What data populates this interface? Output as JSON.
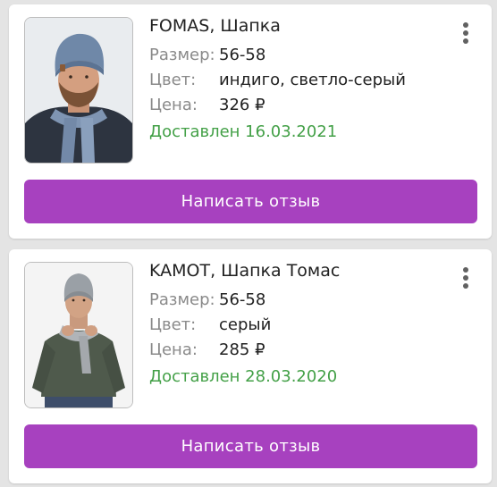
{
  "orders": [
    {
      "title": "FOMAS, Шапка",
      "size_label": "Размер:",
      "size_value": "56-58",
      "color_label": "Цвет:",
      "color_value": "индиго, светло-серый",
      "price_label": "Цена:",
      "price_value": "326 ₽",
      "status": "Доставлен 16.03.2021",
      "button_label": "Написать отзыв",
      "image_icon": "product-photo-hat-scarf"
    },
    {
      "title": "KAMOT, Шапка Томас",
      "size_label": "Размер:",
      "size_value": "56-58",
      "color_label": "Цвет:",
      "color_value": "серый",
      "price_label": "Цена:",
      "price_value": "285 ₽",
      "status": "Доставлен 28.03.2020",
      "button_label": "Написать отзыв",
      "image_icon": "product-photo-hat-sweater"
    }
  ],
  "colors": {
    "accent": "#a741bf",
    "status_green": "#43a047",
    "label_gray": "#8a8a8a",
    "text": "#212121",
    "background": "#e4e4e4"
  }
}
